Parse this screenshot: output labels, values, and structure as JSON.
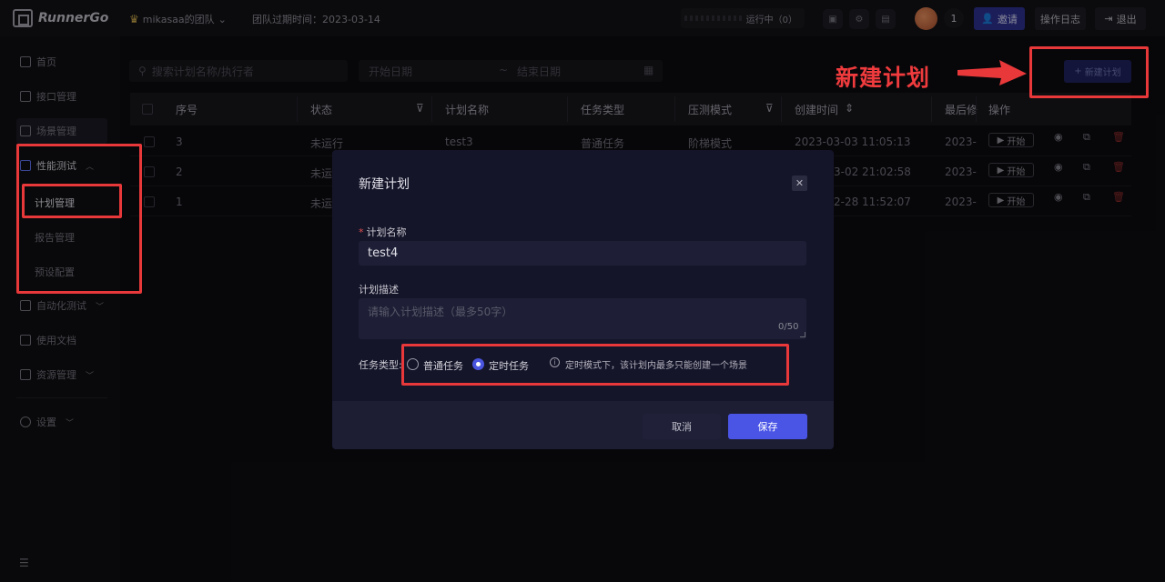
{
  "topbar": {
    "logo_text": "RunnerGo",
    "team_name": "mikasaa的团队",
    "expire_text": "团队过期时间：2023-03-14",
    "running_text": "运行中（0）",
    "member_count": "1",
    "invite_label": "邀请",
    "log_label": "操作日志",
    "logout_label": "退出"
  },
  "sidebar": {
    "home": "首页",
    "api": "接口管理",
    "scene": "场景管理",
    "perf": "性能测试",
    "plan": "计划管理",
    "report": "报告管理",
    "preset": "预设配置",
    "auto": "自动化测试",
    "docs": "使用文档",
    "resource": "资源管理",
    "settings": "设置"
  },
  "toolbar": {
    "search_placeholder": "搜索计划名称/执行者",
    "start_date": "开始日期",
    "date_sep": "~",
    "end_date": "结束日期",
    "new_plan_label": "新建计划"
  },
  "table": {
    "headers": {
      "seq": "序号",
      "status": "状态",
      "name": "计划名称",
      "type": "任务类型",
      "mode": "压测模式",
      "created": "创建时间",
      "modified": "最后修",
      "ops": "操作"
    },
    "start_label": "开始",
    "rows": [
      {
        "seq": "3",
        "status": "未运行",
        "name": "test3",
        "type": "普通任务",
        "mode": "阶梯模式",
        "created": "2023-03-03 11:05:13",
        "modified": "2023-"
      },
      {
        "seq": "2",
        "status": "未运",
        "name": "",
        "type": "",
        "mode": "",
        "created": "3-02 21:02:58",
        "modified": "2023-"
      },
      {
        "seq": "1",
        "status": "未运",
        "name": "",
        "type": "",
        "mode": "",
        "created": "2-28 11:52:07",
        "modified": "2023-"
      }
    ]
  },
  "modal": {
    "title": "新建计划",
    "name_label": "计划名称",
    "name_required_mark": "*",
    "name_value": "test4",
    "desc_label": "计划描述",
    "desc_placeholder": "请输入计划描述（最多50字）",
    "desc_counter": "0/50",
    "type_label": "任务类型:",
    "type_options": [
      "普通任务",
      "定时任务"
    ],
    "type_selected": "定时任务",
    "hint": "定时模式下，该计划内最多只能创建一个场景",
    "cancel_label": "取消",
    "save_label": "保存"
  },
  "annotation": {
    "text": "新建计划",
    "color": "#e8383a"
  }
}
